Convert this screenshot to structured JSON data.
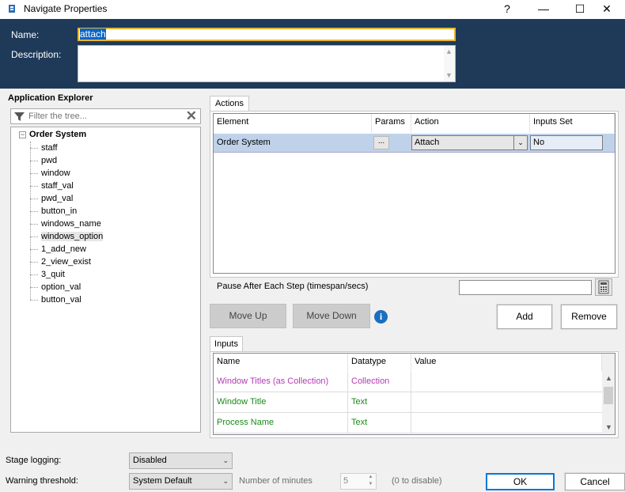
{
  "window": {
    "title": "Navigate Properties",
    "help": "?",
    "minimize": "—",
    "maximize": "☐",
    "close": "✕"
  },
  "header": {
    "name_label": "Name:",
    "name_value": "attach",
    "description_label": "Description:",
    "description_value": ""
  },
  "explorer": {
    "title": "Application Explorer",
    "filter_placeholder": "Filter the tree...",
    "root": "Order System",
    "items": [
      "staff",
      "pwd",
      "window",
      "staff_val",
      "pwd_val",
      "button_in",
      "windows_name",
      "windows_option",
      "1_add_new",
      "2_view_exist",
      "3_quit",
      "option_val",
      "button_val"
    ],
    "selected": "windows_option"
  },
  "actions": {
    "tab_label": "Actions",
    "columns": [
      "Element",
      "Params",
      "Action",
      "Inputs Set"
    ],
    "rows": [
      {
        "element": "Order System",
        "params": "...",
        "action": "Attach",
        "inputs_set": "No"
      }
    ],
    "pause_label": "Pause After Each Step (timespan/secs)",
    "pause_value": "",
    "move_up": "Move Up",
    "move_down": "Move Down",
    "add": "Add",
    "remove": "Remove"
  },
  "inputs": {
    "tab_label": "Inputs",
    "columns": [
      "Name",
      "Datatype",
      "Value"
    ],
    "rows": [
      {
        "name": "Window Titles (as Collection)",
        "datatype": "Collection",
        "value": "",
        "color": "#b23cb2"
      },
      {
        "name": "Window Title",
        "datatype": "Text",
        "value": "",
        "color": "#1a8a1a"
      },
      {
        "name": "Process Name",
        "datatype": "Text",
        "value": "",
        "color": "#1a8a1a"
      }
    ]
  },
  "footer": {
    "stage_logging_label": "Stage logging:",
    "stage_logging_value": "Disabled",
    "warning_label": "Warning threshold:",
    "warning_value": "System Default",
    "minutes_label": "Number of minutes",
    "minutes_value": "5",
    "disable_hint": "(0 to disable)",
    "ok": "OK",
    "cancel": "Cancel"
  }
}
